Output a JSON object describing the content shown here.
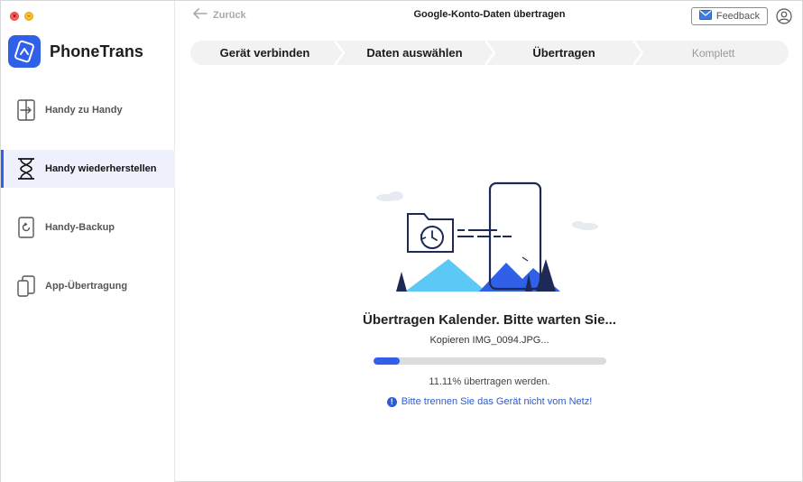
{
  "app": {
    "name": "PhoneTrans"
  },
  "window": {
    "close_glyph": "×",
    "minimize_glyph": "–"
  },
  "sidebar": {
    "items": [
      {
        "label": "Handy zu Handy",
        "icon": "phone-to-phone-icon",
        "active": false
      },
      {
        "label": "Handy wiederherstellen",
        "icon": "hourglass-icon",
        "active": true
      },
      {
        "label": "Handy-Backup",
        "icon": "backup-phone-icon",
        "active": false
      },
      {
        "label": "App-Übertragung",
        "icon": "app-transfer-icon",
        "active": false
      }
    ]
  },
  "header": {
    "back_label": "Zurück",
    "title": "Google-Konto-Daten übertragen",
    "feedback_label": "Feedback"
  },
  "steps": [
    {
      "label": "Gerät verbinden",
      "state": "done"
    },
    {
      "label": "Daten auswählen",
      "state": "done"
    },
    {
      "label": "Übertragen",
      "state": "current"
    },
    {
      "label": "Komplett",
      "state": "pending"
    }
  ],
  "transfer": {
    "status": "Übertragen Kalender. Bitte warten Sie...",
    "file": "Kopieren IMG_0094.JPG...",
    "progress_percent": 11.11,
    "progress_text": "11.11% übertragen werden.",
    "warning": "Bitte trennen Sie das Gerät nicht vom Netz!",
    "warning_icon_glyph": "!"
  },
  "colors": {
    "accent": "#3160e8",
    "link": "#2b5bd7",
    "mountain_light": "#5bc8f5",
    "mountain_dark": "#3160e8",
    "tree": "#1c2a55"
  }
}
